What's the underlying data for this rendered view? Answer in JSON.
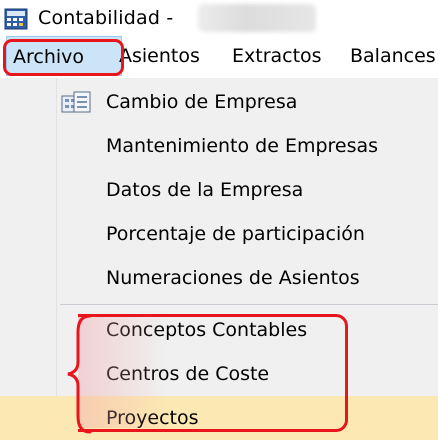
{
  "window": {
    "title": "Contabilidad -",
    "app_icon": "calculator-icon"
  },
  "menubar": {
    "items": [
      {
        "label": "Archivo",
        "active": true
      },
      {
        "label": "Asientos"
      },
      {
        "label": "Extractos"
      },
      {
        "label": "Balances"
      }
    ]
  },
  "dropdown": {
    "items": [
      {
        "label": "Cambio de Empresa",
        "icon": "switch-company-icon"
      },
      {
        "label": "Mantenimiento de Empresas"
      },
      {
        "label": "Datos de la Empresa"
      },
      {
        "label": "Porcentaje de participación"
      },
      {
        "label": "Numeraciones de Asientos"
      },
      {
        "label": "Conceptos Contables"
      },
      {
        "label": "Centros de Coste"
      },
      {
        "label": "Proyectos",
        "highlighted": true
      }
    ]
  },
  "colors": {
    "annotation": "#e8161c",
    "menu_active_bg": "#cce4f7",
    "menu_hover_bg": "#fce8b2",
    "dropdown_bg": "#f0f0f0"
  }
}
